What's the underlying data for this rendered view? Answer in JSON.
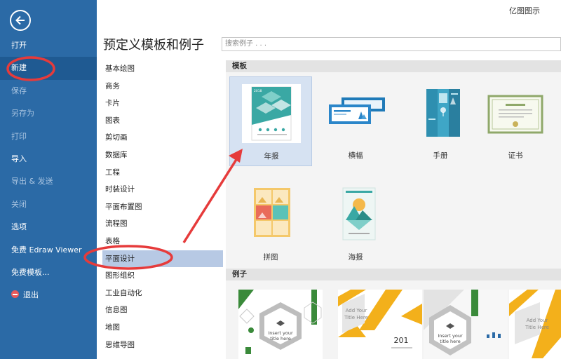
{
  "app_title": "亿图图示",
  "page_title": "预定义模板和例子",
  "search": {
    "placeholder": "搜索例子 . . ."
  },
  "sidebar": {
    "items": [
      {
        "label": "打开",
        "dim": false
      },
      {
        "label": "新建",
        "dim": false,
        "active": true
      },
      {
        "label": "保存",
        "dim": true
      },
      {
        "label": "另存为",
        "dim": true
      },
      {
        "label": "打印",
        "dim": true
      },
      {
        "label": "导入",
        "dim": false
      },
      {
        "label": "导出 & 发送",
        "dim": true
      },
      {
        "label": "关闭",
        "dim": true
      },
      {
        "label": "选项",
        "dim": false
      },
      {
        "label": "免费 Edraw Viewer",
        "dim": false
      },
      {
        "label": "免费模板...",
        "dim": false
      },
      {
        "label": "退出",
        "dim": false,
        "icon": "exit-icon"
      }
    ]
  },
  "categories": [
    "基本绘图",
    "商务",
    "卡片",
    "图表",
    "剪切画",
    "数据库",
    "工程",
    "时装设计",
    "平面布置图",
    "流程图",
    "表格",
    "平面设计",
    "图形组织",
    "工业自动化",
    "信息图",
    "地图",
    "思维导图"
  ],
  "selected_category": "平面设计",
  "templates_heading": "模板",
  "examples_heading": "例子",
  "templates": [
    {
      "label": "年报",
      "icon": "annual-report-icon"
    },
    {
      "label": "横幅",
      "icon": "banner-icon"
    },
    {
      "label": "手册",
      "icon": "brochure-icon"
    },
    {
      "label": "证书",
      "icon": "certificate-icon"
    },
    {
      "label": "拼图",
      "icon": "collage-icon"
    },
    {
      "label": "海报",
      "icon": "poster-icon"
    }
  ],
  "thumb_text": {
    "year_2018": "2018",
    "year_201": "201"
  },
  "examples": {
    "ex1_line1": "Insert your",
    "ex1_line2": "title here",
    "ex2_line1": "Add Your",
    "ex2_line2": "Title Here",
    "ex3_line1": "Insert your",
    "ex3_line2": "title here",
    "ex4_line1": "Add Your",
    "ex4_line2": "Title Here"
  },
  "colors": {
    "sidebar": "#2b6aa6",
    "teal": "#3aa8a4",
    "annotation": "#e63b3b"
  }
}
